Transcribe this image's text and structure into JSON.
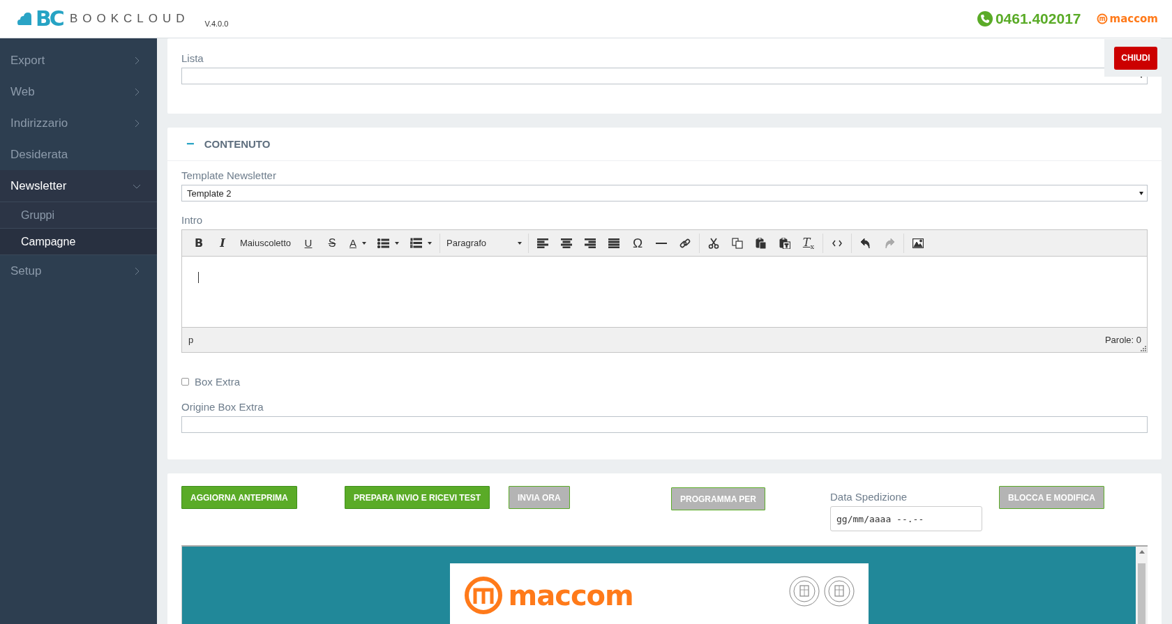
{
  "header": {
    "logo_mark": "BC",
    "brand": "BOOKCLOUD",
    "version": "V.4.0.0",
    "phone": "0461.402017",
    "partner": "maccom"
  },
  "sidebar": {
    "items": [
      {
        "label": "Export",
        "kind": "group",
        "expanded": false,
        "selected": false
      },
      {
        "label": "Web",
        "kind": "group",
        "expanded": false,
        "selected": false
      },
      {
        "label": "Indirizzario",
        "kind": "group",
        "expanded": false,
        "selected": false
      },
      {
        "label": "Desiderata",
        "kind": "link",
        "selected": false
      },
      {
        "label": "Newsletter",
        "kind": "group",
        "expanded": true,
        "selected": false,
        "children": [
          {
            "label": "Gruppi",
            "selected": false
          },
          {
            "label": "Campagne",
            "selected": true
          }
        ]
      },
      {
        "label": "Setup",
        "kind": "group",
        "expanded": false,
        "selected": false
      }
    ]
  },
  "close_button": {
    "label": "CHIUDI"
  },
  "list_field": {
    "label": "Lista"
  },
  "content_section": {
    "toggle": "−",
    "title": "CONTENUTO",
    "template_field": {
      "label": "Template Newsletter",
      "value": "Template 2"
    },
    "intro_editor": {
      "label": "Intro",
      "toolbar": [
        [
          {
            "kind": "bold",
            "text": "B",
            "disabled": false
          },
          {
            "kind": "italic",
            "text": "I",
            "disabled": false
          },
          {
            "kind": "text",
            "text": "Maiuscoletto",
            "disabled": false
          },
          {
            "kind": "underline",
            "text": "U",
            "disabled": false
          },
          {
            "kind": "strike",
            "text": "S",
            "disabled": false
          },
          {
            "kind": "color",
            "text": "A",
            "disabled": false
          },
          {
            "kind": "bullets",
            "disabled": false
          },
          {
            "kind": "numbers",
            "disabled": false
          }
        ],
        [
          {
            "kind": "format",
            "text": "Paragrafo",
            "disabled": false
          }
        ],
        [
          {
            "kind": "align-left",
            "disabled": false
          },
          {
            "kind": "align-center",
            "disabled": false
          },
          {
            "kind": "align-right",
            "disabled": false
          },
          {
            "kind": "justify",
            "disabled": false
          },
          {
            "kind": "glyph",
            "text": "Ω",
            "disabled": false
          },
          {
            "kind": "rule",
            "disabled": false
          },
          {
            "kind": "link",
            "disabled": false
          }
        ],
        [
          {
            "kind": "cut",
            "disabled": false
          },
          {
            "kind": "copy",
            "disabled": false
          },
          {
            "kind": "paste",
            "disabled": false
          },
          {
            "kind": "paste-text",
            "disabled": false
          },
          {
            "kind": "clear",
            "text": "T$_{x}$",
            "disabled": false
          }
        ],
        [
          {
            "kind": "code",
            "disabled": false
          }
        ],
        [
          {
            "kind": "undo",
            "disabled": false
          },
          {
            "kind": "redo",
            "disabled": true
          }
        ],
        [
          {
            "kind": "image",
            "disabled": false
          }
        ]
      ],
      "path": "p",
      "word_count": "Parole: 0"
    },
    "box_extra": {
      "label": "Box Extra",
      "checked": false
    },
    "origin_field": {
      "label": "Origine Box Extra"
    }
  },
  "actions": {
    "buttons": [
      {
        "label": "AGGIORNA ANTEPRIMA",
        "disabled": false
      },
      {
        "label": "PREPARA INVIO E RICEVI TEST",
        "disabled": false
      },
      {
        "label": "INVIA ORA",
        "disabled": true
      },
      {
        "label": "PROGRAMMA PER",
        "disabled": true
      }
    ],
    "date_field": {
      "label": "Data Spedizione",
      "placeholder": "gg/mm/aaaa --.--"
    },
    "lock_button": {
      "label": "BLOCCA E MODIFICA",
      "disabled": true
    }
  },
  "preview": {
    "brand": "maccom"
  }
}
